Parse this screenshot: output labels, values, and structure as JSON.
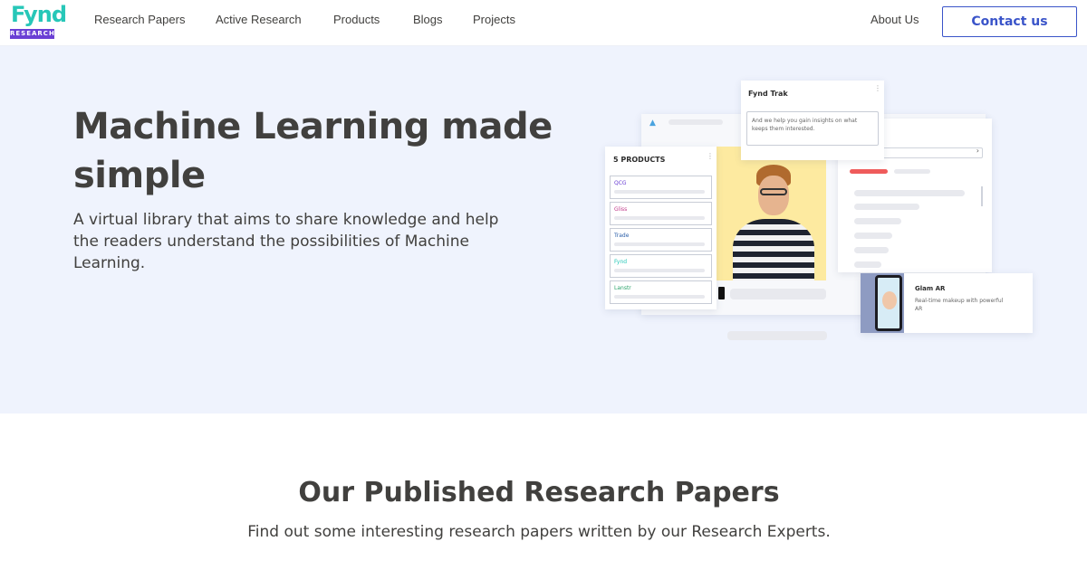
{
  "header": {
    "logo": {
      "word": "Fynd",
      "badge": "RESEARCH"
    },
    "nav": [
      {
        "label": "Research Papers"
      },
      {
        "label": "Active Research"
      },
      {
        "label": "Products"
      },
      {
        "label": "Blogs"
      },
      {
        "label": "Projects"
      }
    ],
    "about_label": "About Us",
    "contact_label": "Contact us"
  },
  "hero": {
    "title": "Machine Learning made simple",
    "description": "A virtual library that aims to share knowledge and help the readers understand the possibilities of Machine Learning."
  },
  "illustration": {
    "products_heading": "5 PRODUCTS",
    "product_tags": [
      "QCG",
      "Gliss",
      "Trade",
      "Fynd",
      "Lanstr"
    ],
    "trak_title": "Fynd Trak",
    "trak_text": "And we help you gain insights on what keeps them interested.",
    "glam_title": "Glam AR",
    "glam_text": "Real-time makeup with powerful AR"
  },
  "section": {
    "title": "Our Published Research Papers",
    "subtitle": "Find out some interesting research papers written by our Research Experts."
  },
  "colors": {
    "accent": "#3a54c9",
    "logo_teal": "#27c7b8",
    "logo_purple": "#6a3fd4",
    "hero_bg": "#eff3fd",
    "text": "#41403e",
    "photo_bg": "#fdeaa0",
    "red_bar": "#ef5b5b"
  }
}
